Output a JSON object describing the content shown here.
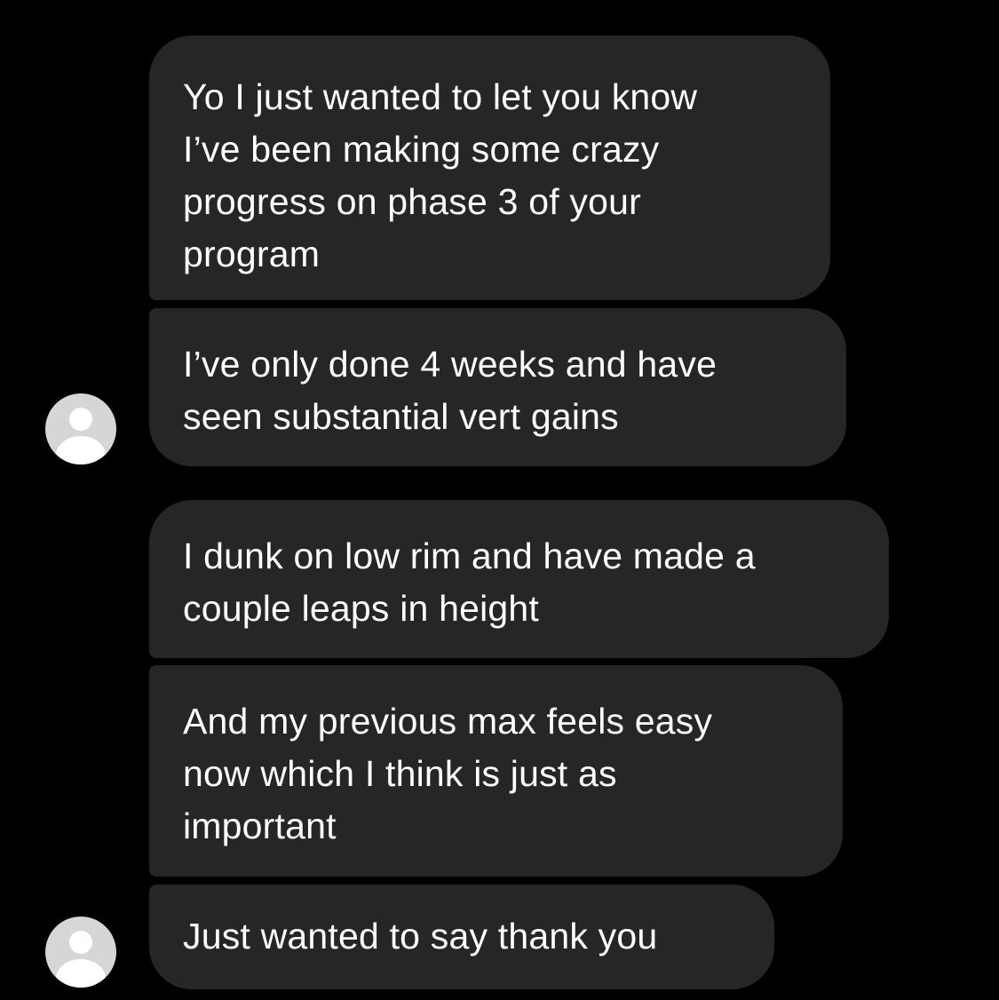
{
  "conversation": {
    "messages": [
      {
        "text": "Yo I just wanted to let you know\nI’ve been making some crazy\nprogress on phase 3 of your\nprogram"
      },
      {
        "text": "I’ve only done 4 weeks and have\nseen substantial vert gains"
      },
      {
        "text": "I dunk on low rim and have made a\ncouple leaps in height"
      },
      {
        "text": "And my previous max feels easy\nnow which I think is just as\nimportant"
      },
      {
        "text": "Just wanted to say thank you"
      }
    ]
  },
  "colors": {
    "background": "#000000",
    "bubble": "#262626",
    "text": "#ffffff",
    "avatar_bg": "#d6d6d6"
  },
  "icons": {
    "avatar": "default-user-avatar-icon"
  }
}
